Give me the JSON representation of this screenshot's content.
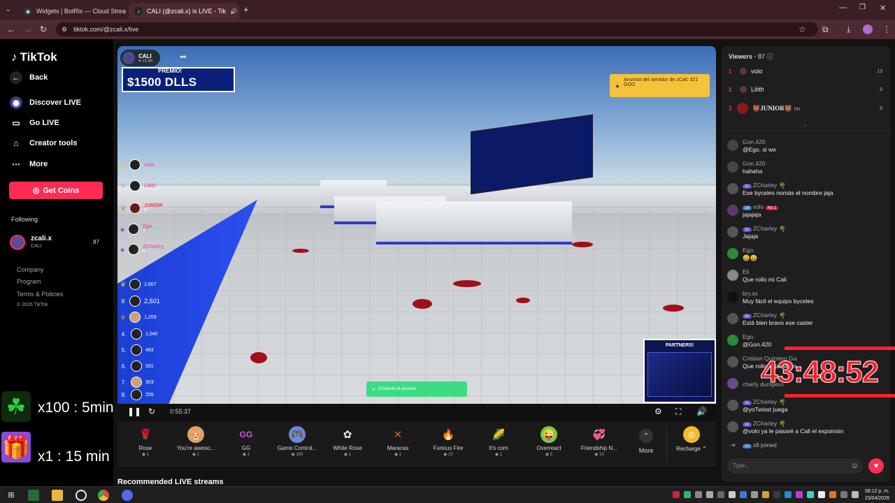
{
  "browser": {
    "tabs": [
      {
        "title": "Widgets | BotRix — Cloud Strea",
        "active": false
      },
      {
        "title": "CALI (@zcali.x) is LIVE - Tik",
        "active": true
      }
    ],
    "url": "tiktok.com/@zcali.x/live"
  },
  "sidebar": {
    "logo": "TikTok",
    "back": "Back",
    "items": [
      {
        "label": "Discover LIVE",
        "icon": "discover-icon"
      },
      {
        "label": "Go LIVE",
        "icon": "camera-icon"
      },
      {
        "label": "Creator tools",
        "icon": "home-icon"
      },
      {
        "label": "More",
        "icon": "dots-icon"
      }
    ],
    "get_coins": "Get Coins",
    "following_label": "Following",
    "following": {
      "name": "zcali.x",
      "sub": "CALI",
      "count": "87"
    },
    "footer": [
      "Company",
      "Program",
      "Terms & Policies",
      "© 2026 TikTok"
    ]
  },
  "stream": {
    "streamer_name": "CALI",
    "streamer_likes": "15.9K",
    "premio_label": "PREMIO!",
    "premio_amount": "$1500 DLLS",
    "announce": "Anuncio del servidor de zCali: 321 GOO",
    "leaderboard_top": [
      {
        "name": "volo",
        "score": "13"
      },
      {
        "name": "Lilith",
        "score": "9"
      },
      {
        "name": "JUNIOR",
        "score": "8"
      },
      {
        "name": "Ego.",
        "score": "7"
      },
      {
        "name": "ZCharley",
        "score": "6"
      }
    ],
    "leaderboard_bottom": [
      {
        "rank": "",
        "score": "2,607"
      },
      {
        "rank": "",
        "score": "2,501"
      },
      {
        "rank": "",
        "score": "1,209"
      },
      {
        "rank": "",
        "score": "1,040"
      },
      {
        "rank": "",
        "score": "483"
      },
      {
        "rank": "",
        "score": "331"
      },
      {
        "rank": "",
        "score": "303"
      },
      {
        "rank": "8.",
        "score": "255"
      }
    ],
    "sending_text": "Enviando el anuncio",
    "partners_label": "PARTNERS!",
    "elapsed": "0:55:37"
  },
  "gifts": [
    {
      "name": "Rose",
      "price": "1",
      "icon": "🌹",
      "color": "#c01030"
    },
    {
      "name": "You're aweso...",
      "price": "1",
      "icon": "🐹",
      "color": "#d9a36a"
    },
    {
      "name": "GG",
      "price": "1",
      "icon": "GG",
      "color": "#b04ad0"
    },
    {
      "name": "Game Control...",
      "price": "100",
      "icon": "🎮",
      "color": "#6a8ad8"
    },
    {
      "name": "White Rose",
      "price": "1",
      "icon": "🌼",
      "color": "#e8e8e8"
    },
    {
      "name": "Maracas",
      "price": "1",
      "icon": "🪇",
      "color": "#d05a3a"
    },
    {
      "name": "Furious Fire",
      "price": "10",
      "icon": "🔥",
      "color": "#ff7a2a"
    },
    {
      "name": "It's corn",
      "price": "1",
      "icon": "🌽",
      "color": "#f2c02a"
    },
    {
      "name": "Overreact",
      "price": "5",
      "icon": "😜",
      "color": "#6ad04a"
    },
    {
      "name": "Friendship N...",
      "price": "10",
      "icon": "💞",
      "color": "#d06a8a"
    }
  ],
  "gift_more": "More",
  "recharge": "Recharge",
  "recommended": "Recommended LIVE streams",
  "viewers": {
    "title": "Viewers",
    "count": "87",
    "top": [
      {
        "rank": "1",
        "name": "volo",
        "score": "13"
      },
      {
        "rank": "2",
        "name": "Lilith",
        "score": "9"
      },
      {
        "rank": "3",
        "name": "JUNIOR",
        "score": "8"
      }
    ]
  },
  "chat": [
    {
      "user": "Gon.420",
      "text": "@Ego. si we",
      "level": ""
    },
    {
      "user": "Gon.420",
      "text": "hahaha",
      "level": ""
    },
    {
      "user": "ZCharley",
      "text": "Ese byceles nomás el nombre jaja",
      "level": "32"
    },
    {
      "user": "volo",
      "text": "jajajaja",
      "level": "18"
    },
    {
      "user": "ZCharley",
      "text": "Jajaja",
      "level": "32"
    },
    {
      "user": "Ego.",
      "text": "😀😀",
      "level": ""
    },
    {
      "user": "Eli",
      "text": "Que rollo mi Cali",
      "level": ""
    },
    {
      "user": "bry.sx",
      "text": "Muy fácil el equipo byceles",
      "level": ""
    },
    {
      "user": "ZCharley",
      "text": "Está bien bravo ese caster",
      "level": "32"
    },
    {
      "user": "Ego.",
      "text": "@Gon.420",
      "level": ""
    },
    {
      "user": "Cristian Quintero Ga",
      "text": "Que rollo le pegaron",
      "level": ""
    },
    {
      "user": "charly dumpero",
      "text": "",
      "level": ""
    },
    {
      "user": "ZCharley",
      "text": "@yoTwisst juega",
      "level": "32"
    },
    {
      "user": "ZCharley",
      "text": "@volo ya le pasaré a Cali el expoinsin",
      "level": "32"
    }
  ],
  "joined": {
    "level": "10",
    "user": "x8",
    "text": "joined"
  },
  "type_placeholder": "Type...",
  "timer": "43:48:52",
  "rewards": [
    {
      "icon": "clover-icon",
      "text": "x100 : 5min"
    },
    {
      "icon": "gift-box-icon",
      "text": "x1 : 15 min"
    }
  ],
  "clock": {
    "time": "08:12 p. m.",
    "date": "23/04/2026"
  }
}
